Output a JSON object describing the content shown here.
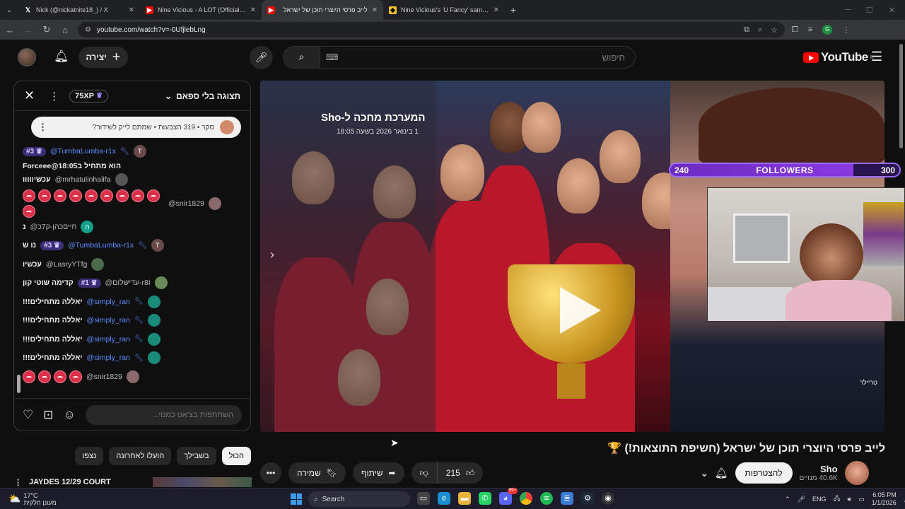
{
  "browser": {
    "tabs": [
      {
        "title": "Nick (@nickatnite18_) / X",
        "icon": "x-logo-icon",
        "active": false
      },
      {
        "title": "Nine Vicious - A LOT (Official M",
        "icon": "youtube-icon",
        "active": false
      },
      {
        "title": "לייב פרסי היוצרי תוכן של ישראל",
        "icon": "youtube-icon",
        "active": true
      },
      {
        "title": "Nine Vicious's 'U Fancy' sample",
        "icon": "whosampled-icon",
        "active": false
      }
    ],
    "url": "youtube.com/watch?v=-0UfjlebLng",
    "profile_initial": "G"
  },
  "youtube": {
    "logo_text": "YouTube",
    "region": "IL",
    "search_placeholder": "חיפוש",
    "create_label": "יצירה"
  },
  "chat": {
    "mode_label": "תצוגה בלי ספאם",
    "xp": "75XP",
    "poll_text": "סקר • 319 הצבעות • שמתם לייק לשידור?",
    "input_placeholder": "השתתפות בצ'אט כמנוי...",
    "messages": [
      {
        "author": "@TumbaLumba-r1x",
        "rank": "#3",
        "text": "הוא מתחיל ב18:05@Forceee",
        "mod": true,
        "avatar": "T",
        "avatar_color": "#6b4a4a"
      },
      {
        "author": "@mrhatulinhalifa",
        "text": "עכשיווווו",
        "avatar": "",
        "avatar_color": "#555"
      },
      {
        "author": "@snir1829",
        "emojis": 10,
        "avatar": "",
        "avatar_color": "#8a6a6a"
      },
      {
        "author": "@חייםכהן-ק7כ",
        "text": "נ",
        "avatar": "ח",
        "avatar_color": "#13a08a"
      },
      {
        "author": "@TumbaLumba-r1x",
        "rank": "#3",
        "text": "נו ש",
        "mod": true,
        "avatar": "T",
        "avatar_color": "#6b4a4a"
      },
      {
        "author": "@LasryYTfg",
        "text": "עכשיו",
        "avatar": "",
        "avatar_color": "#4a6a4a"
      },
      {
        "author": "@עדישלום-r8ו",
        "rank": "#1",
        "text": "קדימה שוטי קון",
        "avatar": "",
        "avatar_color": "#6a8a5a"
      },
      {
        "author": "@simply_ran",
        "text": "יאללה מתחילים!!!",
        "mod": true,
        "avatar": "",
        "avatar_color": "#1a8a7a"
      },
      {
        "author": "@simply_ran",
        "text": "יאללה מתחילים!!!",
        "mod": true,
        "avatar": "",
        "avatar_color": "#1a8a7a"
      },
      {
        "author": "@simply_ran",
        "text": "יאללה מתחילים!!!",
        "mod": true,
        "avatar": "",
        "avatar_color": "#1a8a7a"
      },
      {
        "author": "@simply_ran",
        "text": "יאללה מתחילים!!!",
        "mod": true,
        "avatar": "",
        "avatar_color": "#1a8a7a"
      },
      {
        "author": "@snir1829",
        "emojis": 4,
        "avatar": "",
        "avatar_color": "#8a6a6a"
      }
    ]
  },
  "filters": [
    "הכול",
    "בשבילך",
    "הועלו לאחרונה",
    "נצפו"
  ],
  "up_next_title": "JAYDES 12/29 COURT",
  "player": {
    "premiere_title": "המערכת מחכה ל-Sho",
    "premiere_date": "1 בינואר 2026 בשעה 18:05",
    "trailer_label": "טריילר"
  },
  "overlay": {
    "followers_label": "FOLLOWERS",
    "followers_current": "240",
    "followers_goal": "300",
    "followers_progress": 0.8
  },
  "video": {
    "title": "לייב פרסי היוצרי תוכן של ישראל (חשיפת התוצאות!) 🏆",
    "channel_name": "Sho",
    "subscribers": "40.6K מנויים",
    "join_label": "להצטרפות",
    "likes": "215",
    "share_label": "שיתוף",
    "save_label": "שמירה"
  },
  "taskbar": {
    "temperature": "17°C",
    "weather_text": "מעונן חלקית",
    "search_label": "Search",
    "lang": "ENG",
    "time": "6:05 PM",
    "date": "1/1/2026",
    "badge_count": "99+"
  }
}
